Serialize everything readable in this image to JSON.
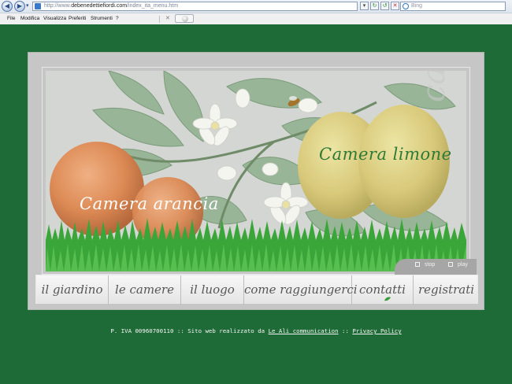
{
  "browser": {
    "address_prefix": "http://www.",
    "address_host": "debenedettiefiordi.com",
    "address_path": "/index_ita_menu.htm",
    "search_placeholder": "Bing",
    "menu": [
      "File",
      "Modifica",
      "Visualizza",
      "Preferiti",
      "Strumenti",
      "?"
    ]
  },
  "hero": {
    "camera_arancia": "Camera arancia",
    "camera_limone": "Camera limone",
    "ghost_text": "camere",
    "stop_label": "stop",
    "play_label": "play"
  },
  "nav": {
    "items": [
      "il giardino",
      "le camere",
      "il luogo",
      "come raggiungerci",
      "contatti",
      "registrati"
    ]
  },
  "footer": {
    "text": "P. IVA 00960700110 :: Sito web realizzato da ",
    "link1": "Le Ali communication",
    "separator": " :: ",
    "link2": "Privacy Policy"
  },
  "colors": {
    "page_bg": "#1e6b37",
    "accent_green": "#2c7a35"
  }
}
